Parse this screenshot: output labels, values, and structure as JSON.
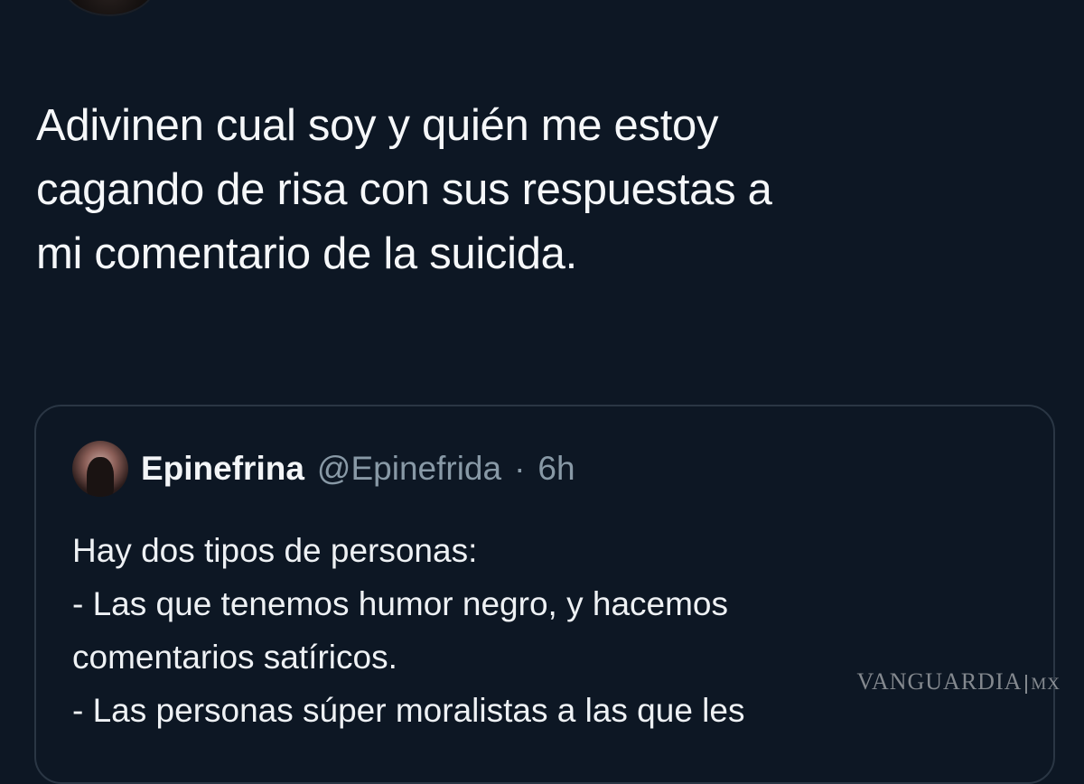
{
  "tweet": {
    "lines": [
      "Adivinen cual soy y quién me estoy",
      "cagando de risa con sus respuestas a",
      "mi comentario de la suicida."
    ]
  },
  "quoted_tweet": {
    "display_name": "Epinefrina",
    "handle": "@Epinefrida",
    "separator": "·",
    "time": "6h",
    "lines": [
      "Hay dos tipos de personas:",
      "- Las que tenemos humor negro, y hacemos",
      "comentarios satíricos.",
      "- Las personas súper moralistas a las que les"
    ]
  },
  "watermark": {
    "brand": "VANGUARDIA",
    "region": "MX"
  },
  "colors": {
    "background": "#0d1724",
    "secondary_text": "#8899a6",
    "card_border": "#2a3644"
  }
}
